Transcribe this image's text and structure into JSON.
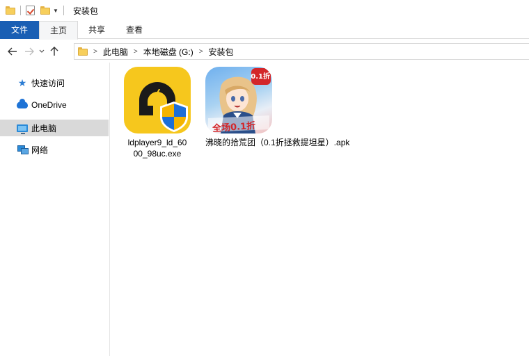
{
  "window": {
    "title": "安装包"
  },
  "ribbon": {
    "tabs": [
      {
        "label": "文件"
      },
      {
        "label": "主页"
      },
      {
        "label": "共享"
      },
      {
        "label": "查看"
      }
    ]
  },
  "nav": {
    "back_icon": "arrow-left-icon",
    "forward_icon": "arrow-right-icon",
    "up_icon": "arrow-up-icon"
  },
  "address": {
    "crumbs": [
      "此电脑",
      "本地磁盘 (G:)",
      "安装包"
    ]
  },
  "sidebar": {
    "items": [
      {
        "label": "快速访问",
        "icon": "star-icon"
      },
      {
        "label": "OneDrive",
        "icon": "cloud-icon"
      },
      {
        "label": "此电脑",
        "icon": "computer-icon",
        "selected": true
      },
      {
        "label": "网络",
        "icon": "network-icon"
      }
    ]
  },
  "files": [
    {
      "name": "ldplayer9_ld_6000_98uc.exe",
      "line1": "ldplayer9_ld_60",
      "line2": "00_98uc.exe",
      "icon": "ldplayer-app-icon"
    },
    {
      "name": "沸晓的拾荒团（0.1折拯救提坦星）.apk",
      "icon": "game-app-icon",
      "badge": "0.1折",
      "banner": "全场0.1折"
    }
  ],
  "colors": {
    "file_tab": "#1a5fb4",
    "selection": "#d9d9d9",
    "ldplayer_yellow": "#f6c71d"
  }
}
